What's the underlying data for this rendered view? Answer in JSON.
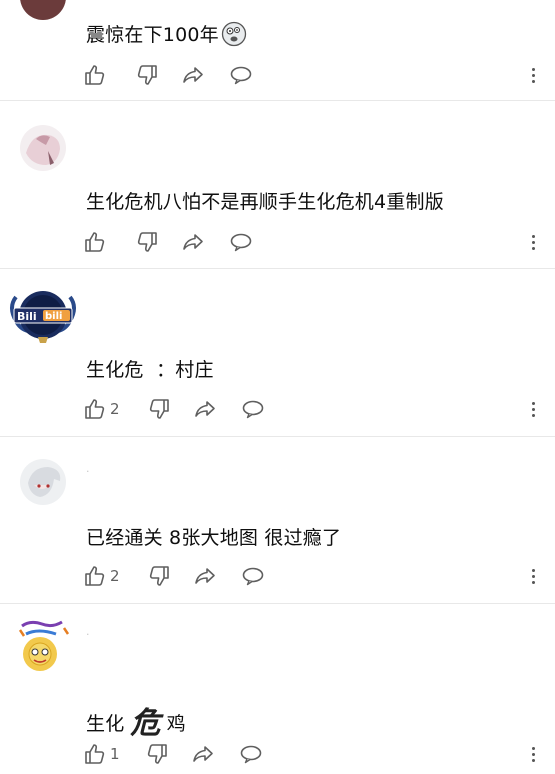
{
  "comments": [
    {
      "username": "",
      "text": "震惊在下100年",
      "likes": "",
      "icons": {
        "like": "thumbs-up-icon",
        "dislike": "thumbs-down-icon",
        "share": "share-icon",
        "reply": "reply-bubble-icon",
        "more": "more-vert-icon"
      }
    },
    {
      "username": "",
      "text": "生化危机八怕不是再顺手生化危机4重制版",
      "likes": ""
    },
    {
      "username": "",
      "avatar_text": "Bilibili",
      "text": "生化危  ：村庄",
      "likes": "2"
    },
    {
      "username": "·",
      "text": "已经通关 8张大地图 很过瘾了",
      "likes": "2"
    },
    {
      "username": "·",
      "text_before": "生化",
      "text_mid": "危",
      "text_after": "鸡",
      "likes": "1"
    }
  ],
  "colors": {
    "divider": "#e8e8e8",
    "icon": "#606060",
    "text": "#0f0f0f"
  }
}
